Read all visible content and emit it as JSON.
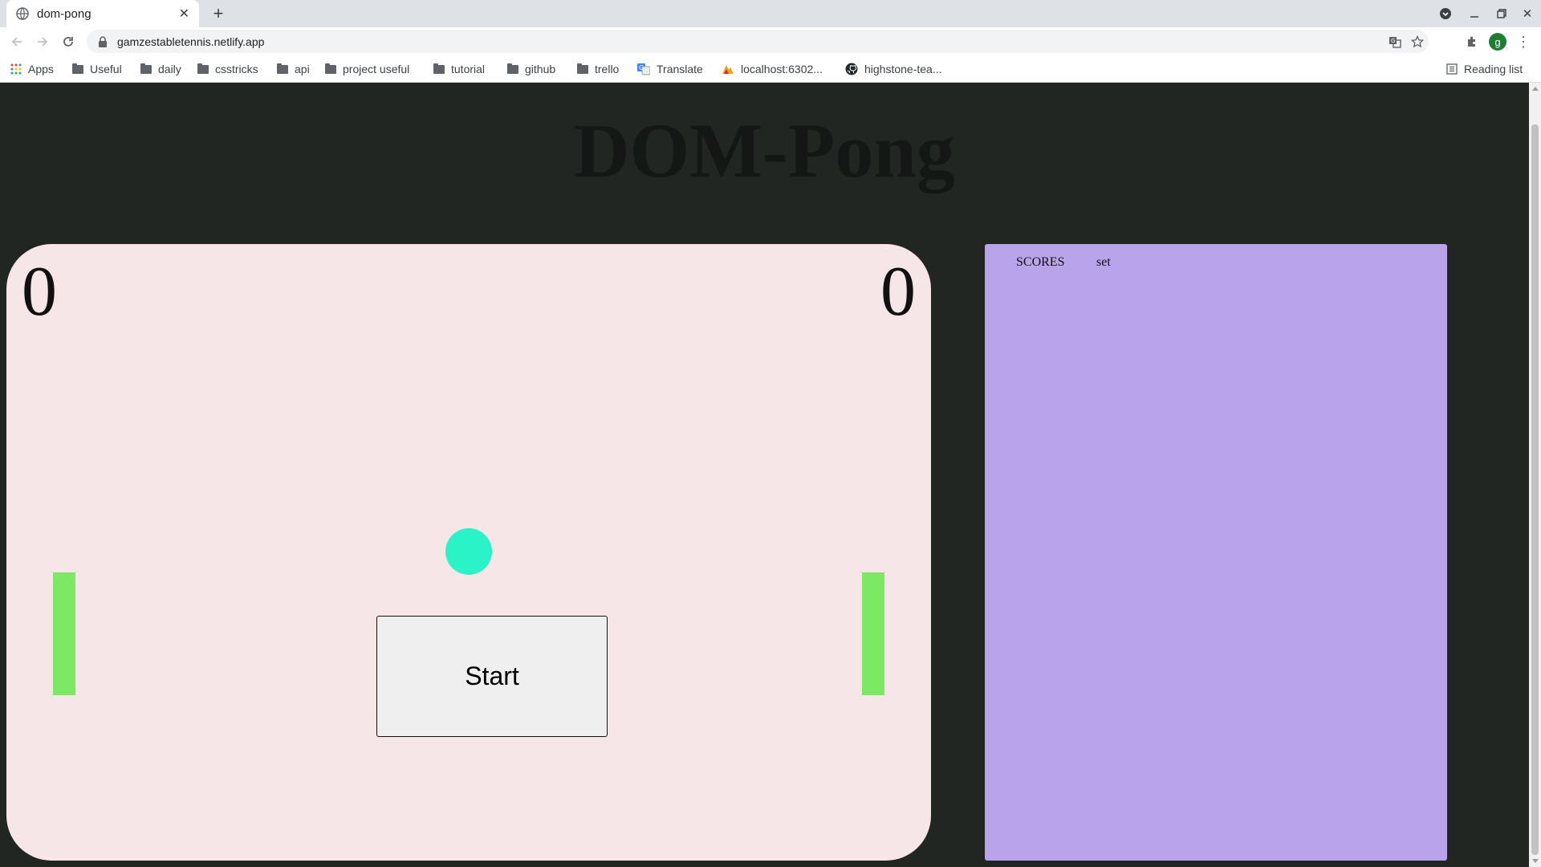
{
  "browser": {
    "tab_title": "dom-pong",
    "url": "gamzestabletennis.netlify.app",
    "avatar_letter": "g",
    "bookmarks": [
      "Apps",
      "Useful",
      "daily",
      "csstricks",
      "api",
      "project useful",
      "tutorial",
      "github",
      "trello",
      "Translate",
      "localhost:6302...",
      "highstone-tea..."
    ],
    "reading_list": "Reading list"
  },
  "page": {
    "title": "DOM-Pong",
    "left_score": "0",
    "right_score": "0",
    "start_label": "Start",
    "scores_panel": {
      "scores_label": "SCORES",
      "set_label": "set"
    }
  },
  "colors": {
    "page_background": "#212623",
    "court": "#f7e6e7",
    "paddle": "#7de864",
    "ball": "#2af4c7",
    "scores_panel": "#b9a3eb"
  }
}
